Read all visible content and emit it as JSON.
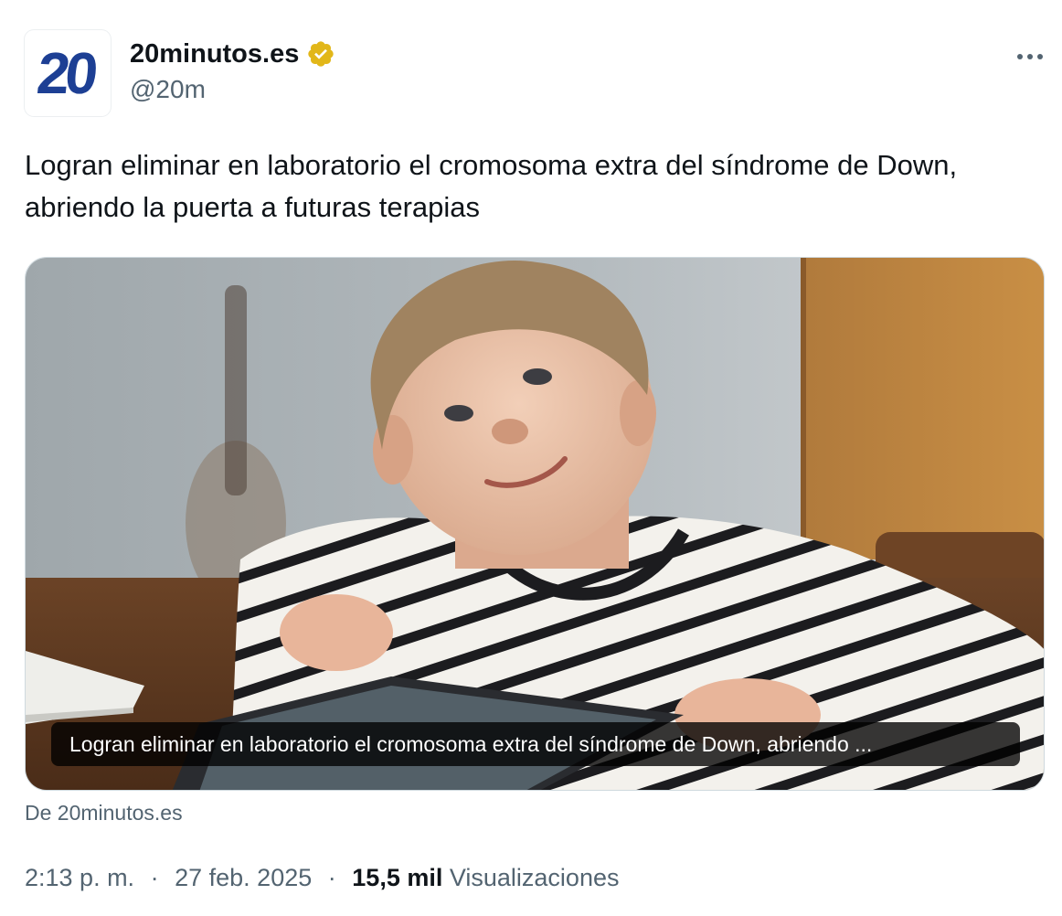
{
  "account": {
    "avatar_text": "20",
    "display_name": "20minutos.es",
    "handle": "@20m"
  },
  "tweet": {
    "text": "Logran eliminar en laboratorio el cromosoma extra del síndrome de Down, abriendo la puerta a futuras terapias",
    "card_caption": "Logran eliminar en laboratorio el cromosoma extra del síndrome de Down, abriendo ...",
    "source": "De 20minutos.es",
    "time": "2:13 p. m.",
    "separator": "·",
    "date": "27 feb. 2025",
    "views_count": "15,5 mil",
    "views_label": "Visualizaciones"
  },
  "icons": {
    "verified": "verified-badge-icon",
    "more": "more-options-icon"
  },
  "colors": {
    "brand_blue": "#1d3f94",
    "verified_gold": "#e2b719",
    "secondary_text": "#536471",
    "primary_text": "#0f1419"
  }
}
